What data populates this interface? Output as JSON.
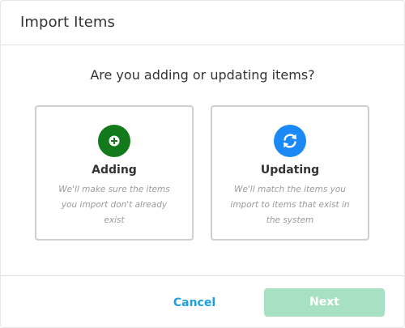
{
  "dialog": {
    "title": "Import Items",
    "question": "Are you adding or updating items?"
  },
  "options": [
    {
      "label": "Adding",
      "description": "We'll make sure the items you import don't already exist",
      "icon": "plus-circle-icon",
      "color": "#127a1a"
    },
    {
      "label": "Updating",
      "description": "We'll match the items you import to items that exist in the system",
      "icon": "refresh-icon",
      "color": "#1a88f5"
    }
  ],
  "footer": {
    "cancel_label": "Cancel",
    "next_label": "Next",
    "next_disabled": true
  },
  "colors": {
    "link": "#1f9fe0",
    "next_disabled_bg": "#a8e0c3"
  }
}
